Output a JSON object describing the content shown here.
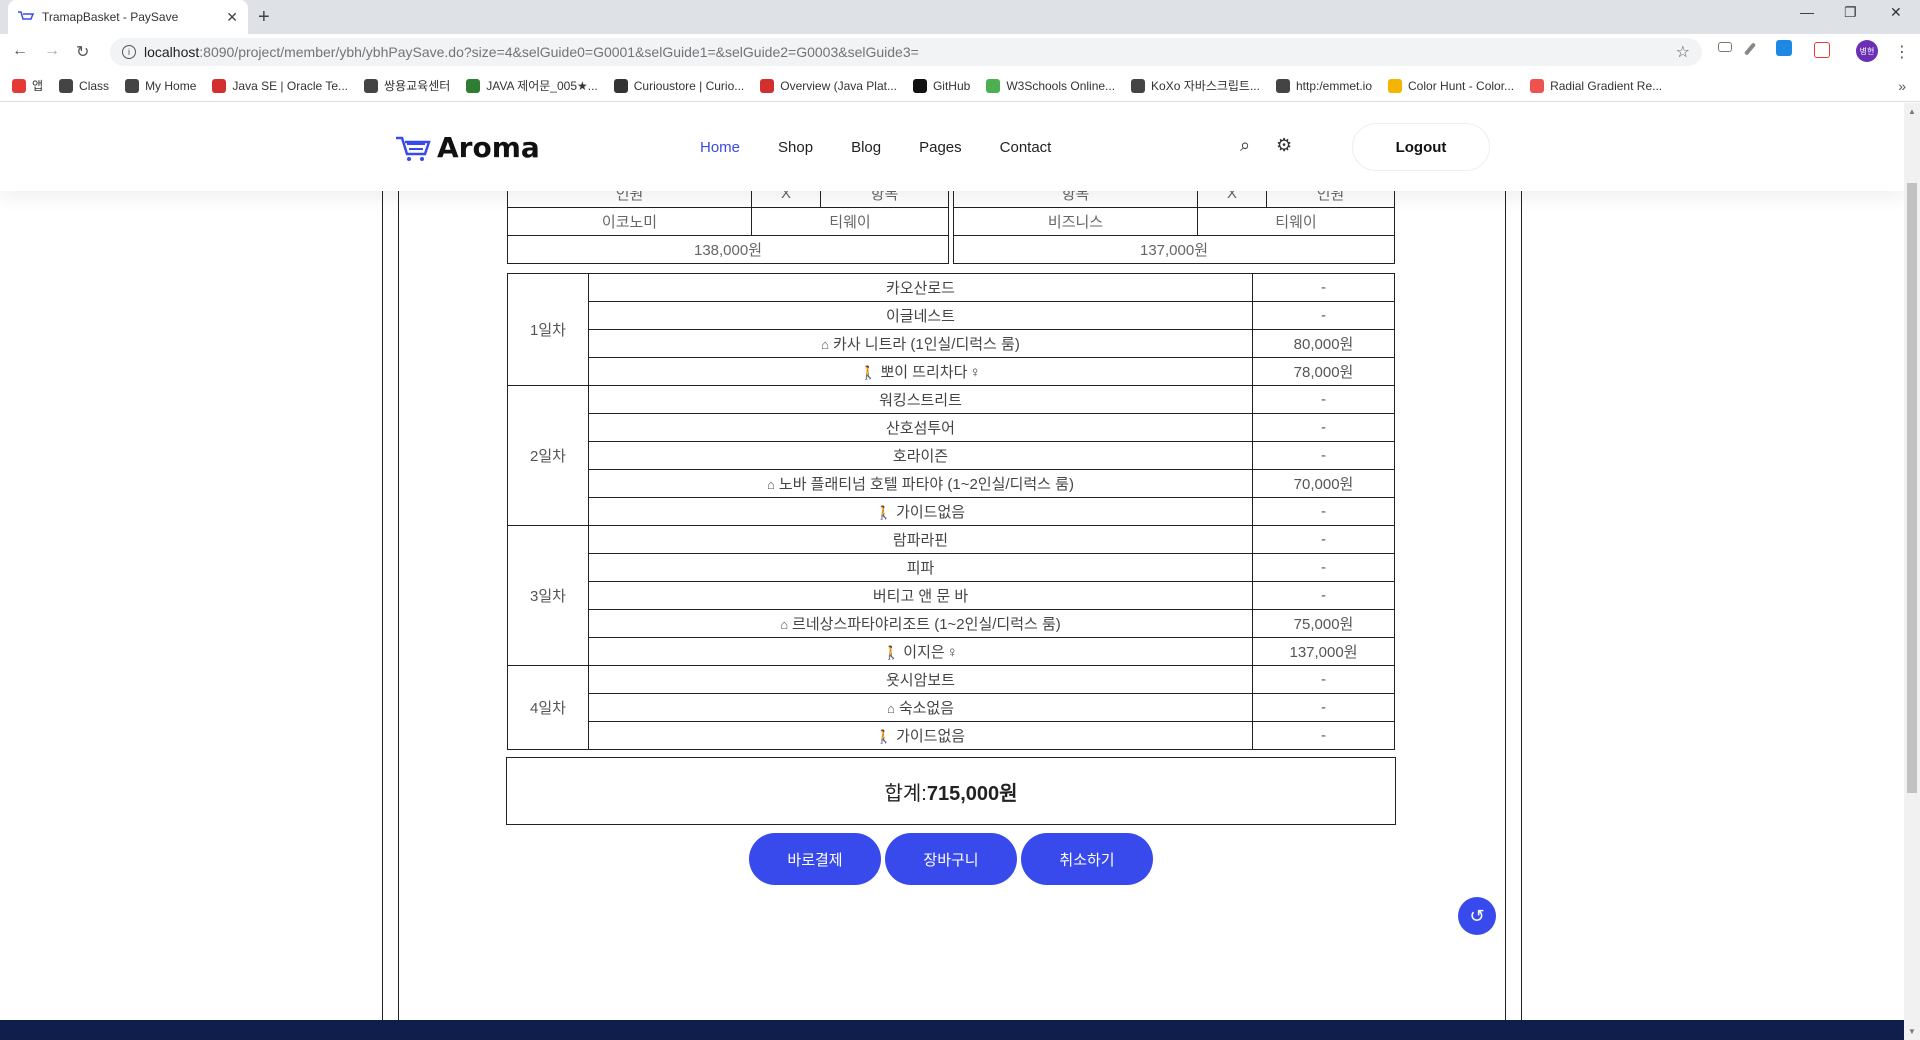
{
  "browser": {
    "tab_title": "TramapBasket - PaySave",
    "close": "✕",
    "new_tab": "+",
    "url_host": "localhost",
    "url_rest": ":8090/project/member/ybh/ybhPaySave.do?size=4&selGuide0=G0001&selGuide1=&selGuide2=G0003&selGuide3=",
    "profile": "병현",
    "bookmarks": [
      {
        "label": "앱",
        "color": "#e53935"
      },
      {
        "label": "Class",
        "color": "#444"
      },
      {
        "label": "My Home",
        "color": "#444"
      },
      {
        "label": "Java SE | Oracle Te...",
        "color": "#d32f2f"
      },
      {
        "label": "쌍용교육센터",
        "color": "#444"
      },
      {
        "label": "JAVA 제어문_005★...",
        "color": "#2e7d32"
      },
      {
        "label": "Curioustore | Curio...",
        "color": "#333"
      },
      {
        "label": "Overview (Java Plat...",
        "color": "#d32f2f"
      },
      {
        "label": "GitHub",
        "color": "#111"
      },
      {
        "label": "W3Schools Online...",
        "color": "#4caf50"
      },
      {
        "label": "KoXo 자바스크립트...",
        "color": "#444"
      },
      {
        "label": "http:/emmet.io",
        "color": "#444"
      },
      {
        "label": "Color Hunt - Color...",
        "color": "#f4b400"
      },
      {
        "label": "Radial Gradient Re...",
        "color": "#ef5350"
      }
    ]
  },
  "header": {
    "logo": "Aroma",
    "nav": [
      "Home",
      "Shop",
      "Blog",
      "Pages",
      "Contact"
    ],
    "logout": "Logout"
  },
  "flights": {
    "left": {
      "top_row": [
        "인원",
        "X",
        "항목"
      ],
      "cells": [
        "이코노미",
        "티웨이"
      ],
      "price": "138,000원"
    },
    "right": {
      "top_row": [
        "항목",
        "X",
        "인원"
      ],
      "cells": [
        "비즈니스",
        "티웨이"
      ],
      "price": "137,000원"
    }
  },
  "itinerary": [
    {
      "day": "1일차",
      "rows": [
        {
          "icon": "",
          "name": "카오산로드",
          "price": "-"
        },
        {
          "icon": "",
          "name": "이글네스트",
          "price": "-"
        },
        {
          "icon": "home",
          "name": "카사 니트라 (1인실/디럭스 룸)",
          "price": "80,000원"
        },
        {
          "icon": "walk",
          "name": "뽀이 뜨리차다",
          "trail": "♀",
          "price": "78,000원"
        }
      ]
    },
    {
      "day": "2일차",
      "rows": [
        {
          "icon": "",
          "name": "워킹스트리트",
          "price": "-"
        },
        {
          "icon": "",
          "name": "산호섬투어",
          "price": "-"
        },
        {
          "icon": "",
          "name": "호라이즌",
          "price": "-"
        },
        {
          "icon": "home",
          "name": "노바 플래티넘 호텔 파타야 (1~2인실/디럭스 룸)",
          "price": "70,000원"
        },
        {
          "icon": "walk",
          "name": "가이드없음",
          "price": "-"
        }
      ]
    },
    {
      "day": "3일차",
      "rows": [
        {
          "icon": "",
          "name": "람파라핀",
          "price": "-"
        },
        {
          "icon": "",
          "name": "피파",
          "price": "-"
        },
        {
          "icon": "",
          "name": "버티고 앤 문 바",
          "price": "-"
        },
        {
          "icon": "home",
          "name": "르네상스파타야리조트 (1~2인실/디럭스 룸)",
          "price": "75,000원"
        },
        {
          "icon": "walk",
          "name": "이지은",
          "trail": "♀",
          "price": "137,000원"
        }
      ]
    },
    {
      "day": "4일차",
      "rows": [
        {
          "icon": "",
          "name": "욧시암보트",
          "price": "-"
        },
        {
          "icon": "home",
          "name": "숙소없음",
          "price": "-"
        },
        {
          "icon": "walk",
          "name": "가이드없음",
          "price": "-"
        }
      ]
    }
  ],
  "total": {
    "label": "합계: ",
    "value": "715,000원"
  },
  "buttons": {
    "pay": "바로결제",
    "cart": "장바구니",
    "cancel": "취소하기"
  }
}
